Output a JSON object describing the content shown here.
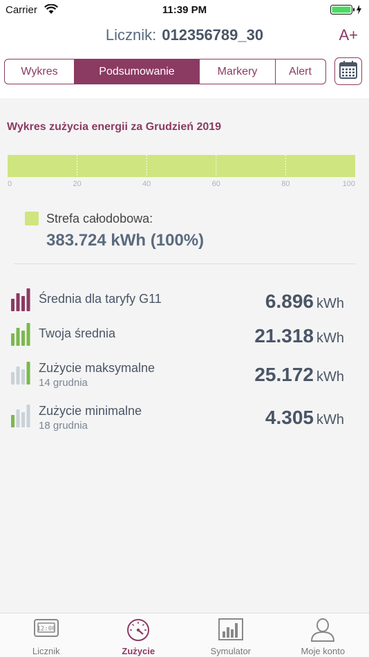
{
  "status_bar": {
    "carrier": "Carrier",
    "time": "11:39 PM"
  },
  "header": {
    "meter_label": "Licznik:",
    "meter_number": "012356789_30",
    "font_size_button": "A+"
  },
  "tabs": [
    {
      "label": "Wykres",
      "active": false
    },
    {
      "label": "Podsumowanie",
      "active": true
    },
    {
      "label": "Markery",
      "active": false
    },
    {
      "label": "Alert",
      "active": false
    }
  ],
  "summary": {
    "chart_title": "Wykres zużycia energii za Grudzień 2019",
    "legend": {
      "label": "Strefa całodobowa:",
      "value": "383.724 kWh (100%)"
    }
  },
  "chart_data": {
    "type": "bar",
    "orientation": "horizontal",
    "stacked": true,
    "categories": [
      "Grudzień 2019"
    ],
    "series": [
      {
        "name": "Strefa całodobowa",
        "values": [
          100
        ],
        "color": "#cfe57f"
      }
    ],
    "xlim": [
      0,
      100
    ],
    "xticks": [
      "0",
      "20",
      "40",
      "60",
      "80",
      "100"
    ],
    "grid": "dashed-vertical"
  },
  "stats": [
    {
      "name": "Średnia dla taryfy G11",
      "sub": "",
      "value": "6.896",
      "unit": "kWh",
      "icon": "tariff-bars-icon"
    },
    {
      "name": "Twoja średnia",
      "sub": "",
      "value": "21.318",
      "unit": "kWh",
      "icon": "average-bars-icon"
    },
    {
      "name": "Zużycie maksymalne",
      "sub": "14 grudnia",
      "value": "25.172",
      "unit": "kWh",
      "icon": "max-bars-icon"
    },
    {
      "name": "Zużycie minimalne",
      "sub": "18 grudnia",
      "value": "4.305",
      "unit": "kWh",
      "icon": "min-bars-icon"
    }
  ],
  "tab_bar": [
    {
      "label": "Licznik",
      "icon": "meter-icon",
      "active": false
    },
    {
      "label": "Zużycie",
      "icon": "speedometer-icon",
      "active": true
    },
    {
      "label": "Symulator",
      "icon": "bar-chart-icon",
      "active": false
    },
    {
      "label": "Moje konto",
      "icon": "user-icon",
      "active": false
    }
  ],
  "colors": {
    "accent": "#8b3a62",
    "zone": "#cfe57f",
    "green": "#7ab94e",
    "text": "#4a5566"
  }
}
